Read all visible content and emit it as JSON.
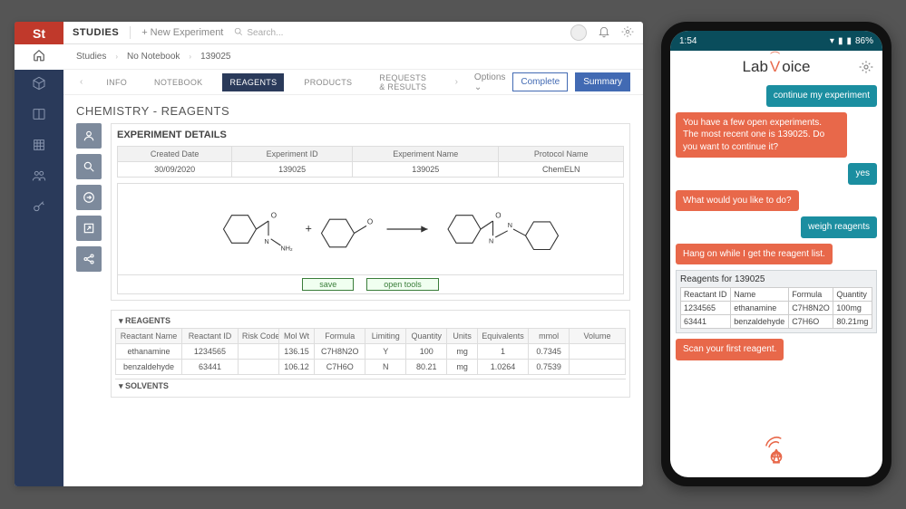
{
  "desktop": {
    "topbar": {
      "title": "STUDIES",
      "new_experiment": "+ New Experiment",
      "search_placeholder": "Search..."
    },
    "breadcrumb": [
      "Studies",
      "No Notebook",
      "139025"
    ],
    "tabs": {
      "items": [
        "INFO",
        "NOTEBOOK",
        "REAGENTS",
        "PRODUCTS",
        "REQUESTS & RESULTS"
      ],
      "active_index": 2,
      "options": "Options",
      "complete": "Complete",
      "summary": "Summary"
    },
    "page_title": "CHEMISTRY - REAGENTS",
    "experiment": {
      "header": "EXPERIMENT DETAILS",
      "columns": [
        "Created Date",
        "Experiment ID",
        "Experiment Name",
        "Protocol Name"
      ],
      "row": [
        "30/09/2020",
        "139025",
        "139025",
        "ChemELN"
      ]
    },
    "panel_buttons": {
      "save": "save",
      "open_tools": "open tools"
    },
    "reagents": {
      "section": "REAGENTS",
      "columns": [
        "Reactant Name",
        "Reactant ID",
        "Risk Code",
        "Mol Wt",
        "Formula",
        "Limiting",
        "Quantity",
        "Units",
        "Equivalents",
        "mmol",
        "Volume"
      ],
      "rows": [
        [
          "ethanamine",
          "1234565",
          "",
          "136.15",
          "C7H8N2O",
          "Y",
          "100",
          "mg",
          "1",
          "0.7345",
          ""
        ],
        [
          "benzaldehyde",
          "63441",
          "",
          "106.12",
          "C7H6O",
          "N",
          "80.21",
          "mg",
          "1.0264",
          "0.7539",
          ""
        ]
      ]
    },
    "solvents": {
      "section": "SOLVENTS"
    }
  },
  "phone": {
    "status": {
      "time": "1:54",
      "battery": "86%"
    },
    "logo": {
      "lab": "Lab",
      "voice": "oice",
      "v": "V"
    },
    "chat": [
      {
        "who": "user",
        "text": "continue my experiment"
      },
      {
        "who": "bot",
        "text": "You have a few open experiments. The most recent one is 139025. Do you want to continue it?"
      },
      {
        "who": "user",
        "text": "yes"
      },
      {
        "who": "bot",
        "text": "What would you like to do?"
      },
      {
        "who": "user",
        "text": "weigh reagents"
      },
      {
        "who": "bot",
        "text": "Hang on while I get the reagent list."
      }
    ],
    "reagent_card": {
      "title": "Reagents for 139025",
      "columns": [
        "Reactant ID",
        "Name",
        "Formula",
        "Quantity"
      ],
      "rows": [
        [
          "1234565",
          "ethanamine",
          "C7H8N2O",
          "100mg"
        ],
        [
          "63441",
          "benzaldehyde",
          "C7H6O",
          "80.21mg"
        ]
      ]
    },
    "chat_after": [
      {
        "who": "bot",
        "text": "Scan your first reagent."
      }
    ]
  }
}
